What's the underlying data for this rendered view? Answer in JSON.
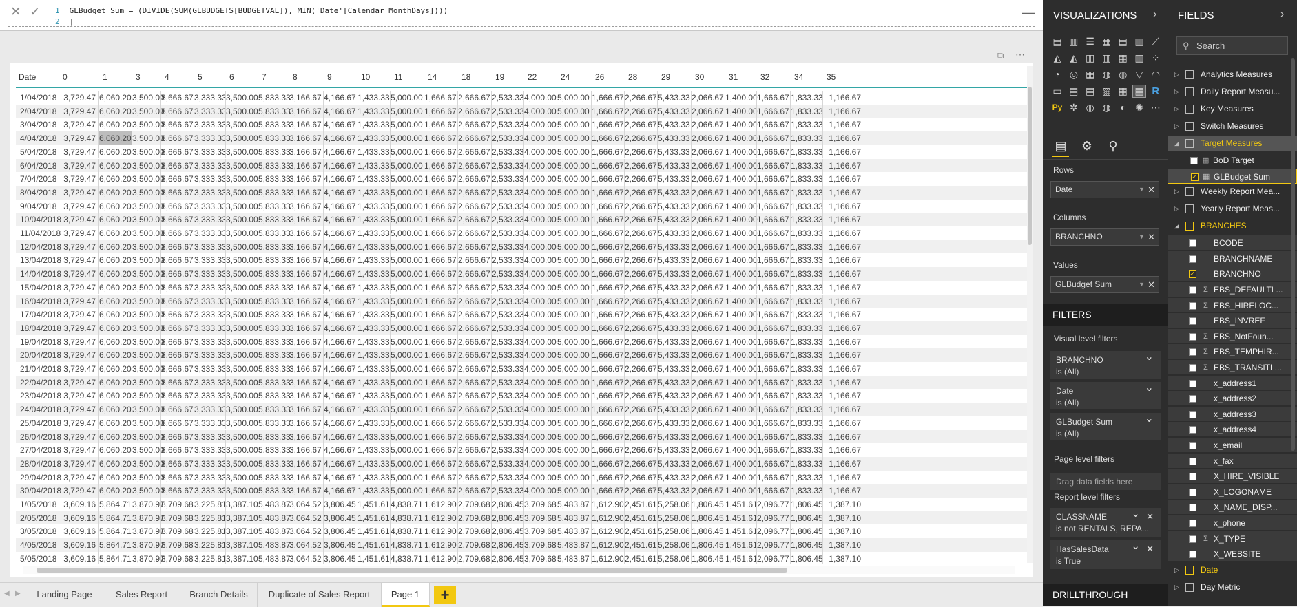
{
  "formula": {
    "line1": "GLBudget Sum = (DIVIDE(SUM(GLBUDGETS[BUDGETVAL]), MIN('Date'[Calendar MonthDays])))",
    "line2": "",
    "ln1": "1",
    "ln2": "2",
    "cancel_icon": "close-icon",
    "commit_icon": "check-icon"
  },
  "visual": {
    "focus_icon": "focus-mode-icon",
    "more_icon": "ellipsis-icon"
  },
  "table": {
    "headers": [
      "Date",
      "0",
      "1",
      "3",
      "4",
      "5",
      "6",
      "7",
      "8",
      "9",
      "10",
      "11",
      "14",
      "18",
      "19",
      "22",
      "24",
      "26",
      "28",
      "29",
      "30",
      "31",
      "32",
      "34",
      "35"
    ],
    "april_values": [
      "3,729.47",
      "6,060.20",
      "3,500.00",
      "8,666.67",
      "3,333.33",
      "3,500.00",
      "5,833.33",
      "3,166.67",
      "4,166.67",
      "1,433.33",
      "5,000.00",
      "1,666.67",
      "2,666.67",
      "2,533.33",
      "4,000.00",
      "5,000.00",
      "1,666.67",
      "2,266.67",
      "5,433.33",
      "2,066.67",
      "1,400.00",
      "1,666.67",
      "1,833.33",
      "1,166.67"
    ],
    "may_values": [
      "3,609.16",
      "5,864.71",
      "3,870.97",
      "8,709.68",
      "3,225.81",
      "3,387.10",
      "5,483.87",
      "3,064.52",
      "3,806.45",
      "1,451.61",
      "4,838.71",
      "1,612.90",
      "2,709.68",
      "2,806.45",
      "3,709.68",
      "5,483.87",
      "1,612.90",
      "2,451.61",
      "5,258.06",
      "1,806.45",
      "1,451.61",
      "2,096.77",
      "1,806.45",
      "1,387.10"
    ],
    "dates": [
      "1/04/2018",
      "2/04/2018",
      "3/04/2018",
      "4/04/2018",
      "5/04/2018",
      "6/04/2018",
      "7/04/2018",
      "8/04/2018",
      "9/04/2018",
      "10/04/2018",
      "11/04/2018",
      "12/04/2018",
      "13/04/2018",
      "14/04/2018",
      "15/04/2018",
      "16/04/2018",
      "17/04/2018",
      "18/04/2018",
      "19/04/2018",
      "20/04/2018",
      "21/04/2018",
      "22/04/2018",
      "23/04/2018",
      "24/04/2018",
      "25/04/2018",
      "26/04/2018",
      "27/04/2018",
      "28/04/2018",
      "29/04/2018",
      "30/04/2018",
      "1/05/2018",
      "2/05/2018",
      "3/05/2018",
      "4/05/2018",
      "5/05/2018"
    ],
    "highlighted_cell": {
      "row": 3,
      "col": 2
    }
  },
  "tabs": [
    "Landing Page",
    "Sales Report",
    "Branch Details",
    "Duplicate of Sales Report",
    "Page 1"
  ],
  "active_tab": "Page 1",
  "add_tab_label": "+",
  "visualizations": {
    "title": "VISUALIZATIONS",
    "rows_label": "Rows",
    "rows_value": "Date",
    "columns_label": "Columns",
    "columns_value": "BRANCHNO",
    "values_label": "Values",
    "values_value": "GLBudget Sum",
    "icons": [
      "stacked-bar-icon",
      "stacked-column-icon",
      "clustered-bar-icon",
      "clustered-column-icon",
      "100-bar-icon",
      "100-column-icon",
      "line-chart-icon",
      "area-chart-icon",
      "stacked-area-icon",
      "line-column-icon",
      "line-clustered-column-icon",
      "ribbon-chart-icon",
      "waterfall-icon",
      "scatter-icon",
      "pie-icon",
      "donut-icon",
      "treemap-icon",
      "map-icon",
      "filled-map-icon",
      "funnel-icon",
      "gauge-icon",
      "card-icon",
      "multirow-card-icon",
      "kpi-icon",
      "slicer-icon",
      "table-icon",
      "matrix-icon",
      "r-visual-icon",
      "python-visual-icon",
      "key-influencers-icon",
      "globe-icon",
      "arcgis-icon",
      "custom-visual-icon",
      "custom-visual2-icon",
      "more-icon"
    ],
    "icon_glyphs": [
      "▤",
      "▥",
      "☰",
      "▦",
      "▤",
      "▥",
      "⟋",
      "◭",
      "◭",
      "▥",
      "▥",
      "▦",
      "▥",
      "⁘",
      "◔",
      "◎",
      "▦",
      "◍",
      "◍",
      "▽",
      "◠",
      "▭",
      "▤",
      "▤",
      "▧",
      "▦",
      "▦",
      "R",
      "Py",
      "✲",
      "◍",
      "◍",
      "◐",
      "✺",
      "⋯"
    ]
  },
  "filters": {
    "title": "FILTERS",
    "visual_level_label": "Visual level filters",
    "visual_filters": [
      {
        "field": "BRANCHNO",
        "state": "is (All)"
      },
      {
        "field": "Date",
        "state": "is (All)"
      },
      {
        "field": "GLBudget Sum",
        "state": "is (All)"
      }
    ],
    "page_level_label": "Page level filters",
    "drag_hint": "Drag data fields here",
    "report_level_label": "Report level filters",
    "report_filters": [
      {
        "field": "CLASSNAME",
        "state": "is not RENTALS, REPA..."
      },
      {
        "field": "HasSalesData",
        "state": "is True"
      }
    ],
    "drillthrough_title": "DRILLTHROUGH"
  },
  "fields": {
    "title": "FIELDS",
    "search_placeholder": "Search",
    "items": [
      {
        "label": "Analytics Measures",
        "type": "table"
      },
      {
        "label": "Daily Report Measu...",
        "type": "table"
      },
      {
        "label": "Key Measures",
        "type": "table"
      },
      {
        "label": "Switch Measures",
        "type": "table"
      },
      {
        "label": "Target Measures",
        "type": "table-open"
      },
      {
        "label": "BoD Target",
        "type": "measure",
        "checked": false
      },
      {
        "label": "GLBudget Sum",
        "type": "measure",
        "checked": true,
        "selected": true
      },
      {
        "label": "Weekly Report Mea...",
        "type": "table"
      },
      {
        "label": "Yearly Report Meas...",
        "type": "table"
      },
      {
        "label": "BRANCHES",
        "type": "table-open-yellow"
      },
      {
        "label": "BCODE",
        "type": "field",
        "checked": false
      },
      {
        "label": "BRANCHNAME",
        "type": "field",
        "checked": false
      },
      {
        "label": "BRANCHNO",
        "type": "field",
        "checked": true
      },
      {
        "label": "EBS_DEFAULTL...",
        "type": "field",
        "sigma": true
      },
      {
        "label": "EBS_HIRELOC...",
        "type": "field",
        "sigma": true
      },
      {
        "label": "EBS_INVREF",
        "type": "field"
      },
      {
        "label": "EBS_NotFoun...",
        "type": "field",
        "sigma": true
      },
      {
        "label": "EBS_TEMPHIR...",
        "type": "field",
        "sigma": true
      },
      {
        "label": "EBS_TRANSITL...",
        "type": "field",
        "sigma": true
      },
      {
        "label": "x_address1",
        "type": "field"
      },
      {
        "label": "x_address2",
        "type": "field"
      },
      {
        "label": "x_address3",
        "type": "field"
      },
      {
        "label": "x_address4",
        "type": "field"
      },
      {
        "label": "x_email",
        "type": "field"
      },
      {
        "label": "x_fax",
        "type": "field"
      },
      {
        "label": "X_HIRE_VISIBLE",
        "type": "field"
      },
      {
        "label": "X_LOGONAME",
        "type": "field"
      },
      {
        "label": "X_NAME_DISP...",
        "type": "field"
      },
      {
        "label": "x_phone",
        "type": "field"
      },
      {
        "label": "X_TYPE",
        "type": "field",
        "sigma": true
      },
      {
        "label": "X_WEBSITE",
        "type": "field"
      },
      {
        "label": "Date",
        "type": "table-yellow"
      },
      {
        "label": "Day Metric",
        "type": "table"
      }
    ]
  }
}
